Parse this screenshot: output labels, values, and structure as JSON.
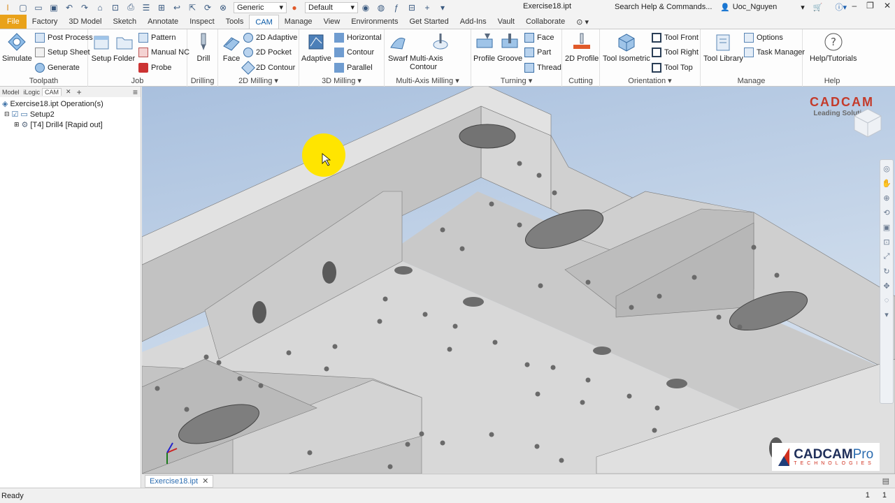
{
  "quick_access": {
    "appearance_value": "Generic",
    "view_value": "Default",
    "document_title": "Exercise18.ipt",
    "help_search_placeholder": "Search Help & Commands...",
    "user_name": "Uoc_Nguyen"
  },
  "menu_tabs": [
    "File",
    "Factory",
    "3D Model",
    "Sketch",
    "Annotate",
    "Inspect",
    "Tools",
    "CAM",
    "Manage",
    "View",
    "Environments",
    "Get Started",
    "Add-Ins",
    "Vault",
    "Collaborate"
  ],
  "active_tab": "CAM",
  "ribbon": {
    "toolpath": {
      "title": "Toolpath",
      "simulate": "Simulate",
      "post_process": "Post Process",
      "setup_sheet": "Setup Sheet",
      "generate": "Generate"
    },
    "job": {
      "title": "Job",
      "setup": "Setup",
      "folder": "Folder",
      "pattern": "Pattern",
      "manual_nc": "Manual NC",
      "probe": "Probe"
    },
    "drilling": {
      "title": "Drilling",
      "drill": "Drill"
    },
    "milling_2d": {
      "title": "2D Milling",
      "face": "Face",
      "adaptive": "2D Adaptive",
      "pocket": "2D Pocket",
      "contour": "2D Contour"
    },
    "milling_3d": {
      "title": "3D Milling",
      "adaptive": "Adaptive",
      "horizontal": "Horizontal",
      "contour": "Contour",
      "parallel": "Parallel"
    },
    "multi_axis": {
      "title": "Multi-Axis Milling",
      "swarf": "Swarf",
      "multi_axis_contour": "Multi-Axis Contour"
    },
    "turning": {
      "title": "Turning",
      "profile": "Profile",
      "groove": "Groove",
      "face": "Face",
      "part": "Part",
      "thread": "Thread"
    },
    "cutting": {
      "title": "Cutting",
      "profile_2d": "2D Profile"
    },
    "orientation": {
      "title": "Orientation",
      "tool_isometric": "Tool Isometric",
      "tool_front": "Tool Front",
      "tool_right": "Tool Right",
      "tool_top": "Tool Top"
    },
    "manage": {
      "title": "Manage",
      "tool_library": "Tool Library",
      "options": "Options",
      "task_manager": "Task Manager"
    },
    "help": {
      "title": "Help",
      "help_tutorials": "Help/Tutorials"
    }
  },
  "browser": {
    "tabs": [
      "Model",
      "iLogic",
      "CAM"
    ],
    "tree": [
      "Exercise18.ipt Operation(s)",
      "Setup2",
      "[T4] Drill4 [Rapid out]"
    ]
  },
  "viewport": {
    "logo_main": "CADCAM",
    "logo_sub": "Leading Solutions",
    "brand_main": "CADCAM",
    "brand_pro": "Pro",
    "brand_sub": "TECHNOLOGIES"
  },
  "doc_tab": "Exercise18.ipt",
  "status": {
    "text": "Ready",
    "num1": "1",
    "num2": "1"
  },
  "colors": {
    "file_tab": "#e9a21a",
    "accent": "#0b5ba8",
    "highlight": "#ffe500"
  }
}
